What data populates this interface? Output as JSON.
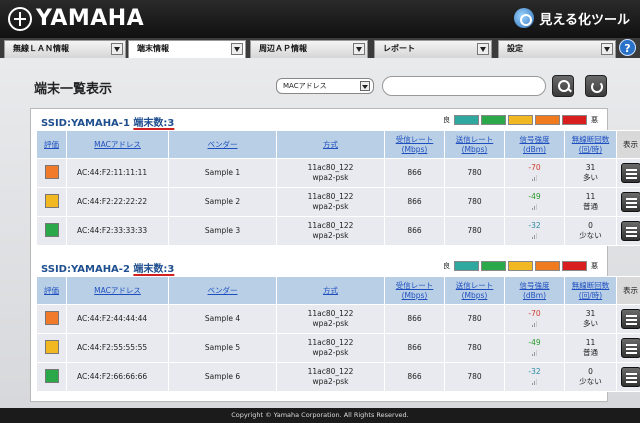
{
  "brand": {
    "logo_text": "YAMAHA",
    "tool_name": "見える化ツール"
  },
  "tabs": [
    {
      "label": "無線ＬＡＮ情報",
      "active": false
    },
    {
      "label": "端末情報",
      "active": true
    },
    {
      "label": "周辺ＡＰ情報",
      "active": false
    },
    {
      "label": "レポート",
      "active": false
    },
    {
      "label": "設定",
      "active": false
    }
  ],
  "help_label": "?",
  "page": {
    "title": "端末一覧表示"
  },
  "search": {
    "select_value": "MACアドレス",
    "input_value": ""
  },
  "legend": {
    "good_label": "良",
    "bad_label": "悪",
    "colors": [
      "#2fa8a0",
      "#2aa84a",
      "#f2b822",
      "#f07a1e",
      "#d81e1e"
    ]
  },
  "columns": {
    "eval": "評価",
    "mac": "MACアドレス",
    "vendor": "ベンダー",
    "method": "方式",
    "rx": "受信レート",
    "rx_unit": "(Mbps)",
    "tx": "送信レート",
    "tx_unit": "(Mbps)",
    "signal": "信号強度",
    "signal_unit": "(dBm)",
    "disconnect": "無線断回数",
    "disconnect_unit": "(回/時)",
    "view": "表示"
  },
  "ssids": [
    {
      "name": "SSID:YAMAHA-1",
      "count_label": "端末数:3",
      "rows": [
        {
          "color": "#f07a2a",
          "mac": "AC:44:F2:11:11:11",
          "vendor": "Sample 1",
          "method1": "11ac80_122",
          "method2": "wpa2-psk",
          "rx": "866",
          "tx": "780",
          "signal": "-70",
          "signal_level": "hi",
          "disc": "31",
          "disc_label": "多い",
          "disc_level": "hi"
        },
        {
          "color": "#f2b822",
          "mac": "AC:44:F2:22:22:22",
          "vendor": "Sample 2",
          "method1": "11ac80_122",
          "method2": "wpa2-psk",
          "rx": "866",
          "tx": "780",
          "signal": "-49",
          "signal_level": "mid",
          "disc": "11",
          "disc_label": "普通",
          "disc_level": "mid"
        },
        {
          "color": "#2aa84a",
          "mac": "AC:44:F2:33:33:33",
          "vendor": "Sample 3",
          "method1": "11ac80_122",
          "method2": "wpa2-psk",
          "rx": "866",
          "tx": "780",
          "signal": "-32",
          "signal_level": "low",
          "disc": "0",
          "disc_label": "少ない",
          "disc_level": "lo"
        }
      ]
    },
    {
      "name": "SSID:YAMAHA-2",
      "count_label": "端末数:3",
      "rows": [
        {
          "color": "#f07a2a",
          "mac": "AC:44:F2:44:44:44",
          "vendor": "Sample 4",
          "method1": "11ac80_122",
          "method2": "wpa2-psk",
          "rx": "866",
          "tx": "780",
          "signal": "-70",
          "signal_level": "hi",
          "disc": "31",
          "disc_label": "多い",
          "disc_level": "hi"
        },
        {
          "color": "#f2b822",
          "mac": "AC:44:F2:55:55:55",
          "vendor": "Sample 5",
          "method1": "11ac80_122",
          "method2": "wpa2-psk",
          "rx": "866",
          "tx": "780",
          "signal": "-49",
          "signal_level": "mid",
          "disc": "11",
          "disc_label": "普通",
          "disc_level": "mid"
        },
        {
          "color": "#2aa84a",
          "mac": "AC:44:F2:66:66:66",
          "vendor": "Sample 6",
          "method1": "11ac80_122",
          "method2": "wpa2-psk",
          "rx": "866",
          "tx": "780",
          "signal": "-32",
          "signal_level": "low",
          "disc": "0",
          "disc_label": "少ない",
          "disc_level": "lo"
        }
      ]
    }
  ],
  "footer": "Copyright © Yamaha Corporation. All Rights Reserved."
}
